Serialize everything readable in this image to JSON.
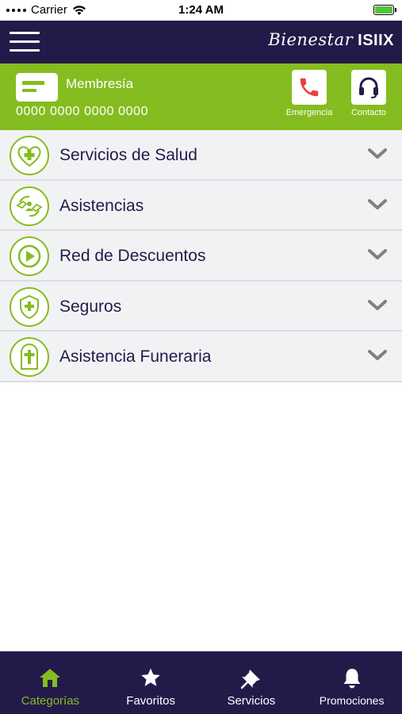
{
  "status_bar": {
    "carrier": "Carrier",
    "time": "1:24 AM"
  },
  "header": {
    "brand_script": "Bienestar",
    "brand_logo": "ISIIX",
    "menu_icon": "hamburger-icon"
  },
  "membership": {
    "title": "Membresía",
    "number": "0000 0000 0000 0000",
    "card_icon": "card-icon",
    "actions": [
      {
        "label": "Emergencia",
        "icon": "phone-icon"
      },
      {
        "label": "Contacto",
        "icon": "headset-icon"
      }
    ]
  },
  "categories": [
    {
      "label": "Servicios de Salud",
      "icon": "heart-cross-icon"
    },
    {
      "label": "Asistencias",
      "icon": "helping-hands-icon"
    },
    {
      "label": "Red de Descuentos",
      "icon": "play-icon"
    },
    {
      "label": "Seguros",
      "icon": "shield-cross-icon"
    },
    {
      "label": "Asistencia Funeraria",
      "icon": "tomb-cross-icon"
    }
  ],
  "tabs": [
    {
      "label": "Categorías",
      "icon": "home-icon",
      "active": true
    },
    {
      "label": "Favoritos",
      "icon": "star-icon",
      "active": false
    },
    {
      "label": "Servicios",
      "icon": "pin-icon",
      "active": false
    },
    {
      "label": "Promociones",
      "icon": "bell-icon",
      "active": false
    }
  ],
  "colors": {
    "navy": "#241a4a",
    "green": "#85bc1f",
    "list_bg": "#f1f2f4",
    "emergency_red": "#e8403a"
  }
}
